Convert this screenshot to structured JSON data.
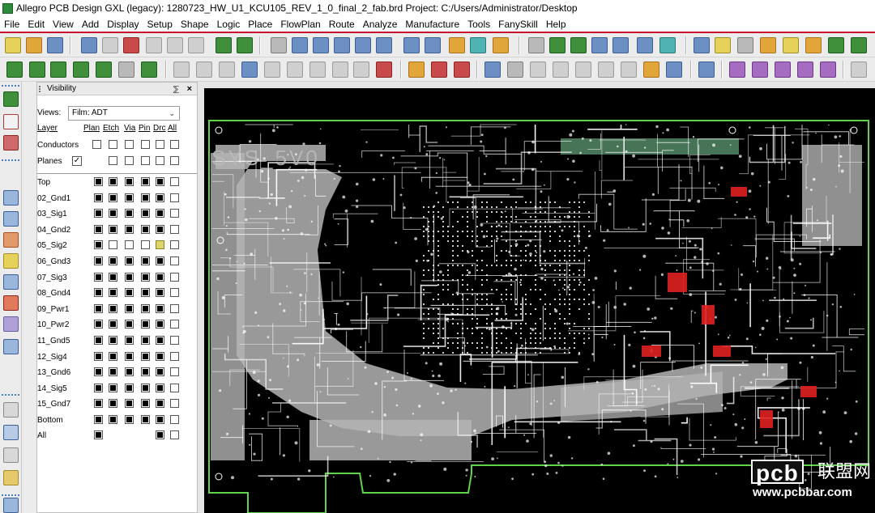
{
  "window": {
    "title": "Allegro PCB Design GXL (legacy): 1280723_HW_U1_KCU105_REV_1_0_final_2_fab.brd  Project: C:/Users/Administrator/Desktop"
  },
  "menu": [
    "File",
    "Edit",
    "View",
    "Add",
    "Display",
    "Setup",
    "Shape",
    "Logic",
    "Place",
    "FlowPlan",
    "Route",
    "Analyze",
    "Manufacture",
    "Tools",
    "FanySkill",
    "Help"
  ],
  "visibility": {
    "title": "Visibility",
    "pin": "⅀",
    "close": "×",
    "views_label": "Views:",
    "views_value": "Film: ADT",
    "columns": {
      "layer": "Layer",
      "plan": "Plan",
      "etch": "Etch",
      "via": "Via",
      "pin": "Pin",
      "drc": "Drc",
      "all": "All"
    },
    "global_rows": [
      {
        "label": "Conductors"
      },
      {
        "label": "Planes"
      }
    ],
    "layers": [
      {
        "name": "Top",
        "plan": true,
        "etch": true,
        "via": true,
        "pin": true,
        "drc": true,
        "all": false
      },
      {
        "name": "02_Gnd1",
        "plan": true,
        "etch": true,
        "via": true,
        "pin": true,
        "drc": true,
        "all": false
      },
      {
        "name": "03_Sig1",
        "plan": true,
        "etch": true,
        "via": true,
        "pin": true,
        "drc": true,
        "all": false
      },
      {
        "name": "04_Gnd2",
        "plan": true,
        "etch": true,
        "via": true,
        "pin": true,
        "drc": true,
        "all": false
      },
      {
        "name": "05_Sig2",
        "plan": true,
        "etch": false,
        "via": false,
        "pin": false,
        "drc": "yellow",
        "all": false
      },
      {
        "name": "06_Gnd3",
        "plan": true,
        "etch": true,
        "via": true,
        "pin": true,
        "drc": true,
        "all": false
      },
      {
        "name": "07_Sig3",
        "plan": true,
        "etch": true,
        "via": true,
        "pin": true,
        "drc": true,
        "all": false
      },
      {
        "name": "08_Gnd4",
        "plan": true,
        "etch": true,
        "via": true,
        "pin": true,
        "drc": true,
        "all": false
      },
      {
        "name": "09_Pwr1",
        "plan": true,
        "etch": true,
        "via": true,
        "pin": true,
        "drc": true,
        "all": false
      },
      {
        "name": "10_Pwr2",
        "plan": true,
        "etch": true,
        "via": true,
        "pin": true,
        "drc": true,
        "all": false
      },
      {
        "name": "11_Gnd5",
        "plan": true,
        "etch": true,
        "via": true,
        "pin": true,
        "drc": true,
        "all": false
      },
      {
        "name": "12_Sig4",
        "plan": true,
        "etch": true,
        "via": true,
        "pin": true,
        "drc": true,
        "all": false
      },
      {
        "name": "13_Gnd6",
        "plan": true,
        "etch": true,
        "via": true,
        "pin": true,
        "drc": true,
        "all": false
      },
      {
        "name": "14_Sig5",
        "plan": true,
        "etch": true,
        "via": true,
        "pin": true,
        "drc": true,
        "all": false
      },
      {
        "name": "15_Gnd7",
        "plan": true,
        "etch": true,
        "via": true,
        "pin": true,
        "drc": true,
        "all": false
      },
      {
        "name": "Bottom",
        "plan": true,
        "etch": true,
        "via": true,
        "pin": true,
        "drc": true,
        "all": false
      }
    ],
    "all_row": {
      "name": "All"
    }
  },
  "board": {
    "net_label": "SYS_5V0"
  },
  "watermark": {
    "brand": "pcb",
    "cn": "联盟网",
    "url": "www.pcbbar.com"
  },
  "colors": {
    "plane": "#b4b4b4",
    "trace": "#ffffff",
    "outline": "#5fd34a",
    "drc": "#e02020",
    "connector": "#4f7f5f"
  }
}
